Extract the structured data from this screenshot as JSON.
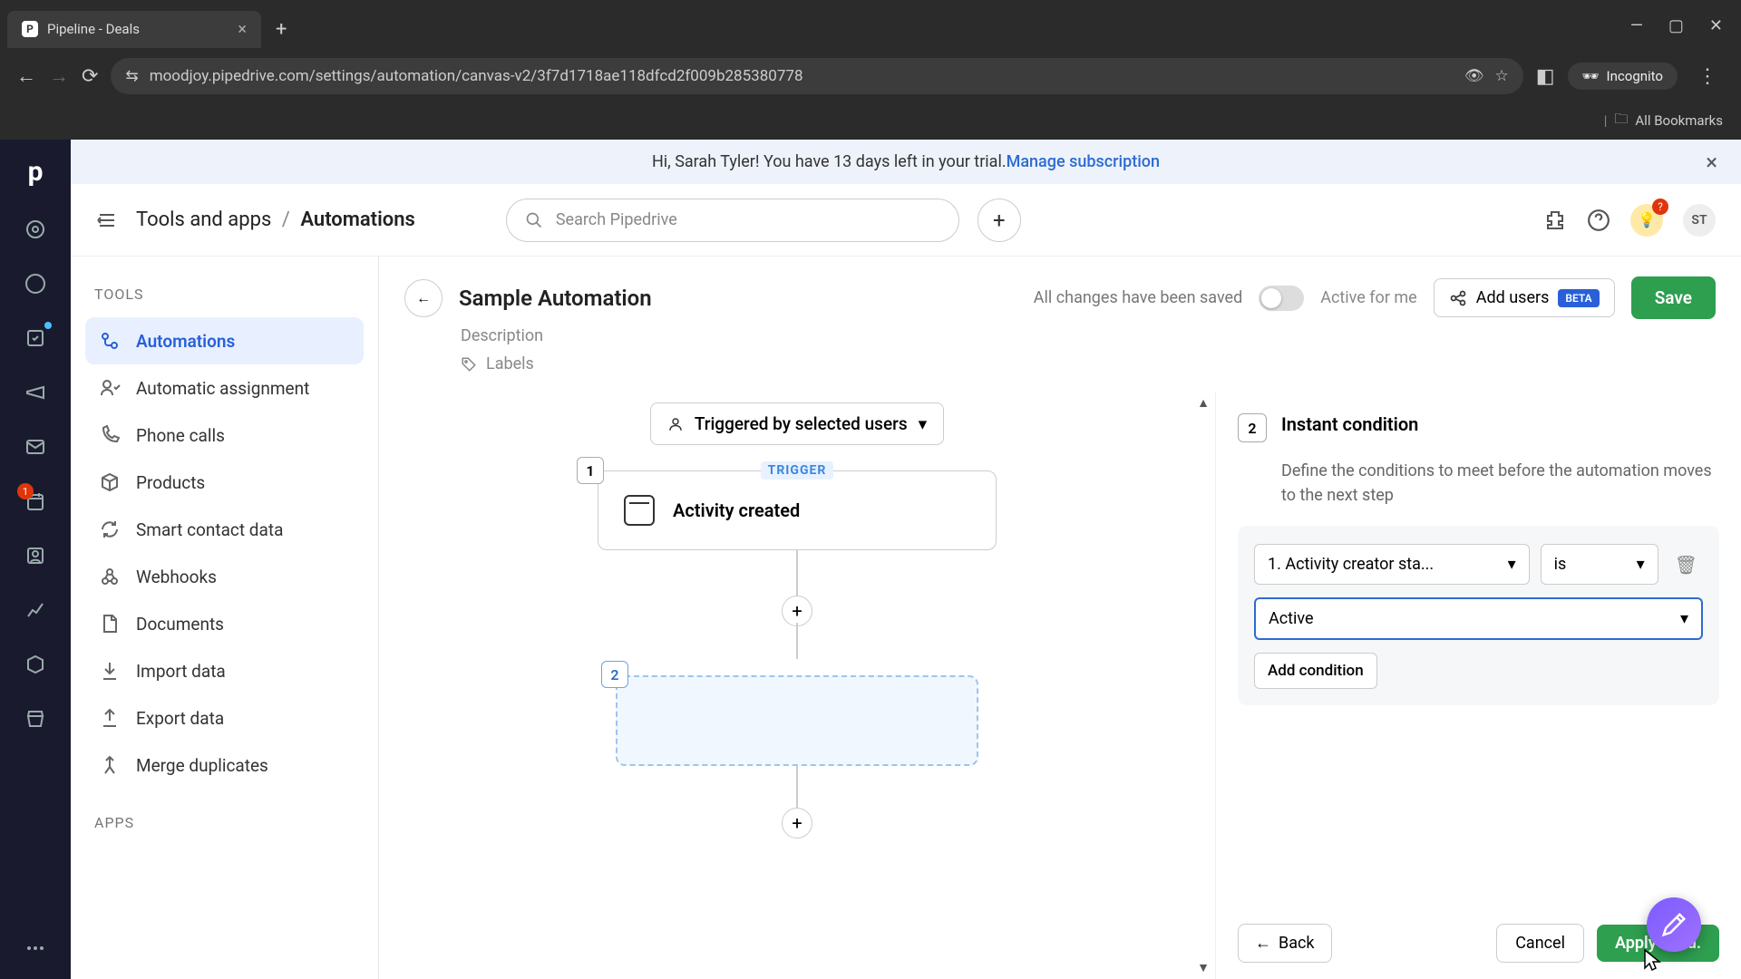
{
  "browser": {
    "tab_title": "Pipeline - Deals",
    "url": "moodjoy.pipedrive.com/settings/automation/canvas-v2/3f7d1718ae118dfcd2f009b285380778",
    "incognito": "Incognito",
    "all_bookmarks": "All Bookmarks"
  },
  "banner": {
    "text_pre": "Hi, Sarah Tyler! You have 13 days left in your trial. ",
    "link": "Manage subscription"
  },
  "header": {
    "breadcrumb_parent": "Tools and apps",
    "breadcrumb_current": "Automations",
    "search_placeholder": "Search Pipedrive",
    "avatar": "ST"
  },
  "sidebar": {
    "section1": "TOOLS",
    "items": [
      "Automations",
      "Automatic assignment",
      "Phone calls",
      "Products",
      "Smart contact data",
      "Webhooks",
      "Documents",
      "Import data",
      "Export data",
      "Merge duplicates"
    ],
    "section2": "APPS"
  },
  "editor": {
    "title": "Sample Automation",
    "description": "Description",
    "labels": "Labels",
    "saved": "All changes have been saved",
    "active_for_me": "Active for me",
    "add_users": "Add users",
    "beta": "BETA",
    "save": "Save",
    "triggered_by": "Triggered by selected users",
    "trigger_label": "TRIGGER",
    "step1_num": "1",
    "step1_title": "Activity created",
    "step2_num": "2"
  },
  "panel": {
    "num": "2",
    "title": "Instant condition",
    "desc": "Define the conditions to meet before the automation moves to the next step",
    "field": "1. Activity creator sta...",
    "operator": "is",
    "value": "Active",
    "add_condition": "Add condition",
    "back": "Back",
    "cancel": "Cancel",
    "apply": "Apply cond."
  },
  "rail_badge": "1"
}
